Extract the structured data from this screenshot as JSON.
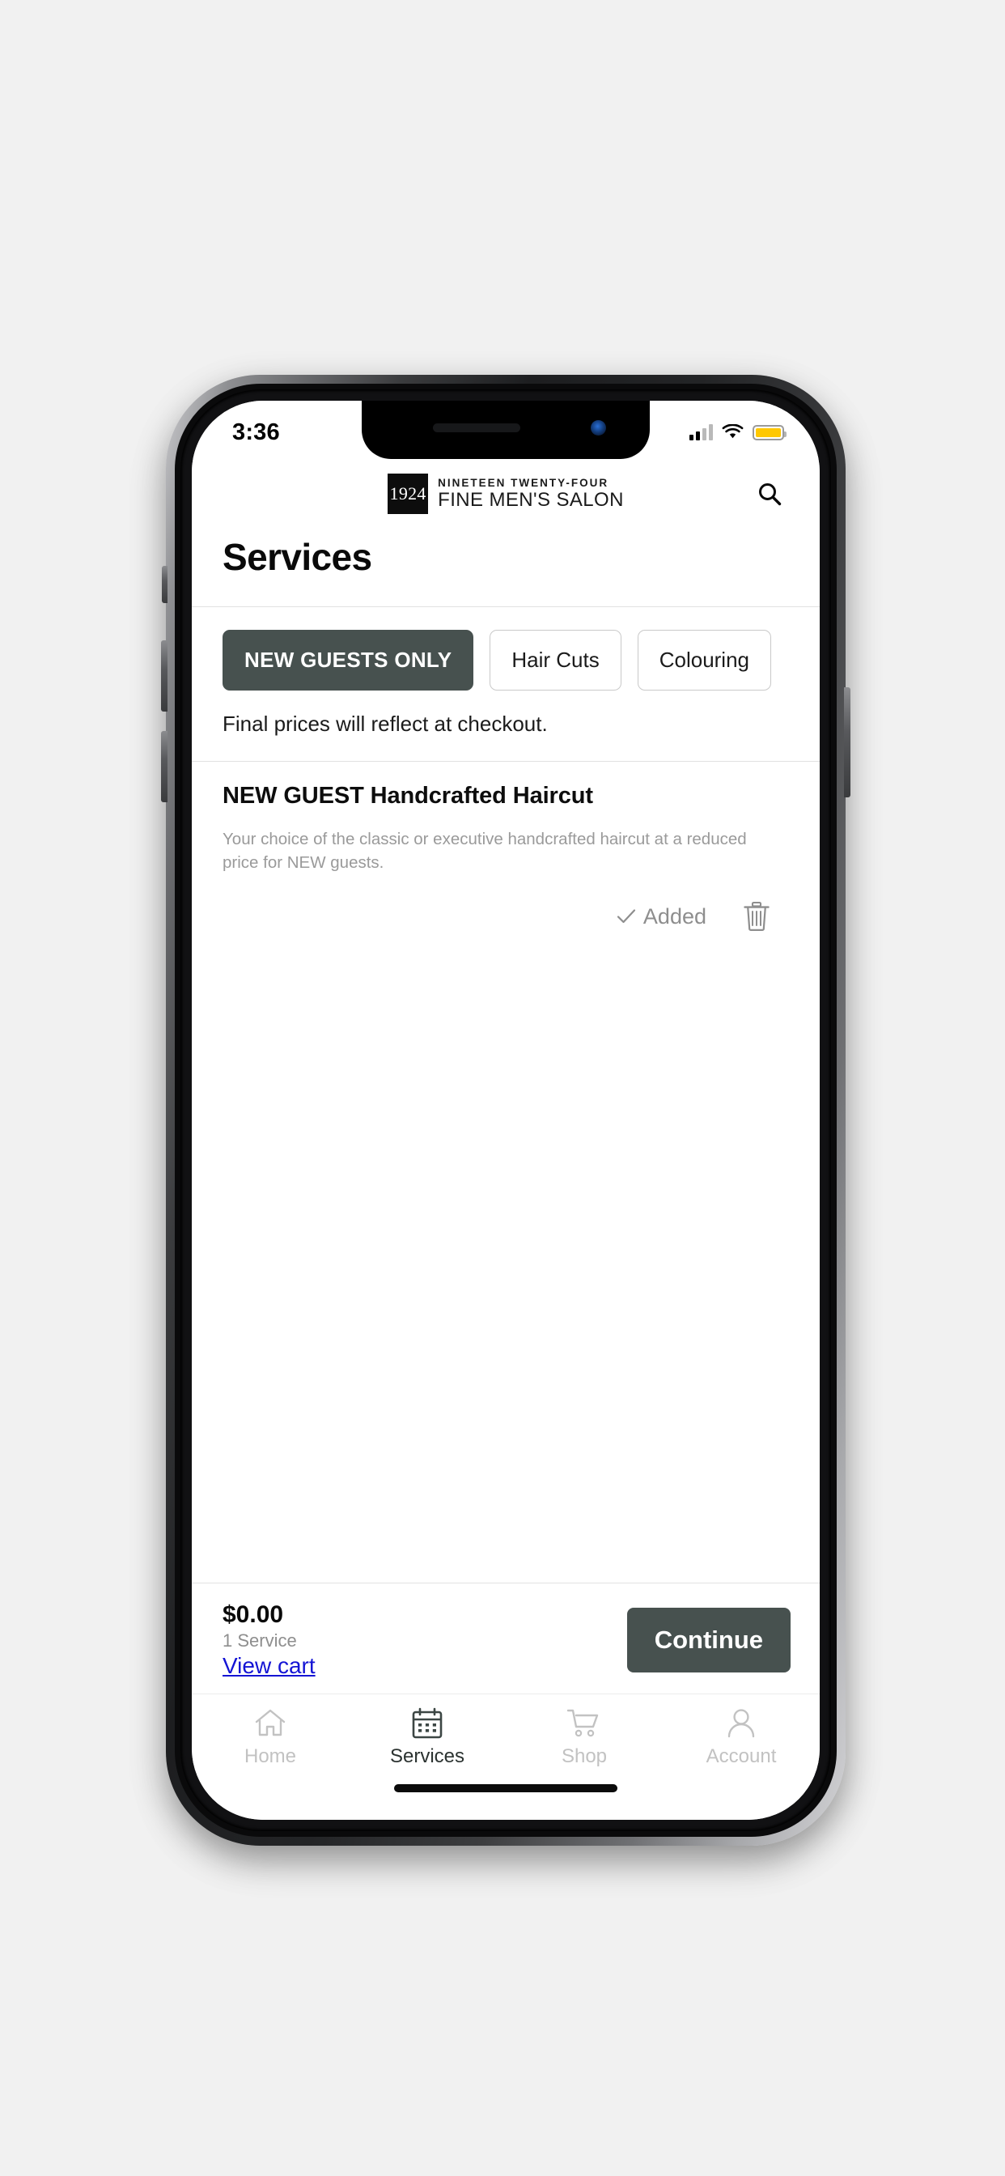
{
  "status_bar": {
    "time": "3:36",
    "signal_icon": "cellular-signal-icon",
    "wifi_icon": "wifi-icon",
    "battery_icon": "battery-icon",
    "battery_color": "#ffc800"
  },
  "header": {
    "logo_mark_text": "1924",
    "logo_line1": "NINETEEN TWENTY-FOUR",
    "logo_line2": "FINE MEN'S SALON",
    "search_icon": "search-icon"
  },
  "page": {
    "title": "Services",
    "note": "Final prices will reflect at checkout."
  },
  "categories": {
    "selected": "NEW GUESTS ONLY",
    "items": [
      {
        "label": "NEW GUESTS ONLY",
        "active": true
      },
      {
        "label": "Hair Cuts",
        "active": false
      },
      {
        "label": "Colouring",
        "active": false
      }
    ]
  },
  "services": [
    {
      "name": "NEW GUEST Handcrafted Haircut",
      "description": "Your choice of the classic or executive handcrafted haircut at a reduced price for NEW guests.",
      "status_label": "Added",
      "status_icon": "check-icon",
      "remove_icon": "trash-icon"
    }
  ],
  "cart": {
    "total": "$0.00",
    "count": "1 Service",
    "view_cart_label": "View cart",
    "continue_label": "Continue",
    "accent_color": "#47514f",
    "link_color": "#1414d4"
  },
  "tabbar": {
    "items": [
      {
        "label": "Home",
        "icon": "home-icon",
        "active": false
      },
      {
        "label": "Services",
        "icon": "calendar-icon",
        "active": true
      },
      {
        "label": "Shop",
        "icon": "cart-icon",
        "active": false
      },
      {
        "label": "Account",
        "icon": "person-icon",
        "active": false
      }
    ]
  }
}
